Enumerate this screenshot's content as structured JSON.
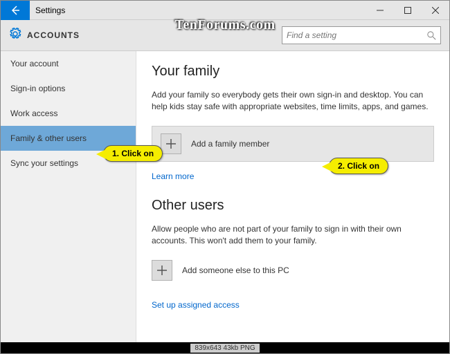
{
  "titlebar": {
    "app": "Settings"
  },
  "header": {
    "title": "ACCOUNTS",
    "search_placeholder": "Find a setting"
  },
  "sidebar": {
    "items": [
      {
        "label": "Your account"
      },
      {
        "label": "Sign-in options"
      },
      {
        "label": "Work access"
      },
      {
        "label": "Family & other users"
      },
      {
        "label": "Sync your settings"
      }
    ]
  },
  "main": {
    "family_heading": "Your family",
    "family_desc": "Add your family so everybody gets their own sign-in and desktop. You can help kids stay safe with appropriate websites, time limits, apps, and games.",
    "add_family_label": "Add a family member",
    "learn_more": "Learn more",
    "other_heading": "Other users",
    "other_desc": "Allow people who are not part of your family to sign in with their own accounts. This won't add them to your family.",
    "add_other_label": "Add someone else to this PC",
    "assigned_access": "Set up assigned access"
  },
  "callouts": {
    "c1": "1. Click on",
    "c2": "2. Click on"
  },
  "watermark": "TenForums.com",
  "footer": "839x643  43kb  PNG"
}
